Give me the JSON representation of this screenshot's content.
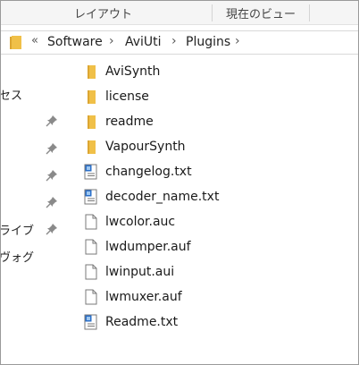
{
  "ribbon": {
    "tabs": [
      "レイアウト",
      "現在のビュー"
    ]
  },
  "address": {
    "overflow": "«",
    "crumbs": [
      "Software",
      "AviUti",
      "Plugins"
    ],
    "separator": "›"
  },
  "nav": {
    "items": [
      "セス",
      "",
      "",
      "",
      "ライブ",
      "ヴォグ"
    ]
  },
  "files": [
    {
      "name": "AviSynth",
      "type": "folder"
    },
    {
      "name": "license",
      "type": "folder"
    },
    {
      "name": "readme",
      "type": "folder"
    },
    {
      "name": "VapourSynth",
      "type": "folder"
    },
    {
      "name": "changelog.txt",
      "type": "text-file"
    },
    {
      "name": "decoder_name.txt",
      "type": "text-file"
    },
    {
      "name": "lwcolor.auc",
      "type": "blank-file"
    },
    {
      "name": "lwdumper.auf",
      "type": "blank-file"
    },
    {
      "name": "lwinput.aui",
      "type": "blank-file"
    },
    {
      "name": "lwmuxer.auf",
      "type": "blank-file"
    },
    {
      "name": "Readme.txt",
      "type": "text-file"
    }
  ],
  "colors": {
    "folder": "#f0c048",
    "folder_dark": "#dca632",
    "text_icon": "#2a6fc9"
  }
}
